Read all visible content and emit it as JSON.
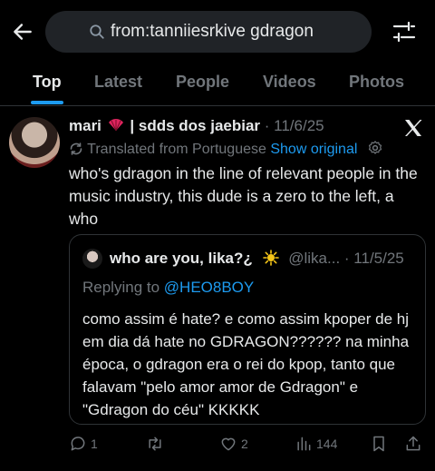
{
  "search": {
    "query": "from:tanniiesrkive gdragon"
  },
  "tabs": [
    {
      "label": "Top",
      "active": true
    },
    {
      "label": "Latest"
    },
    {
      "label": "People"
    },
    {
      "label": "Videos"
    },
    {
      "label": "Photos"
    }
  ],
  "tweet": {
    "name": "mari",
    "name_suffix": "| sdds dos jaebiar",
    "date": "· 11/6/25",
    "translated_from": "Translated from Portuguese",
    "show_original": "Show original",
    "text": "who's gdragon in the line of relevant people in the music industry, this dude is a zero to the left, a who",
    "quote": {
      "name": "who are you, lika?¿",
      "handle": "@lika...",
      "date": "· 11/5/25",
      "replying_to_label": "Replying to",
      "replying_to_handle": "@HEO8BOY",
      "text": "como assim é hate? e como assim kpoper de hj em dia dá hate no GDRAGON?????? na minha época, o gdragon era o rei do kpop, tanto que falavam \"pelo amor amor de Gdragon\" e \"Gdragon do céu\" KKKKK"
    },
    "actions": {
      "replies": "1",
      "reposts": "",
      "likes": "2",
      "views": "144"
    }
  },
  "colors": {
    "background": "#000000",
    "text": "#e7e9ea",
    "muted": "#71767b",
    "accent": "#1d9bf0",
    "border": "#2f3336"
  }
}
